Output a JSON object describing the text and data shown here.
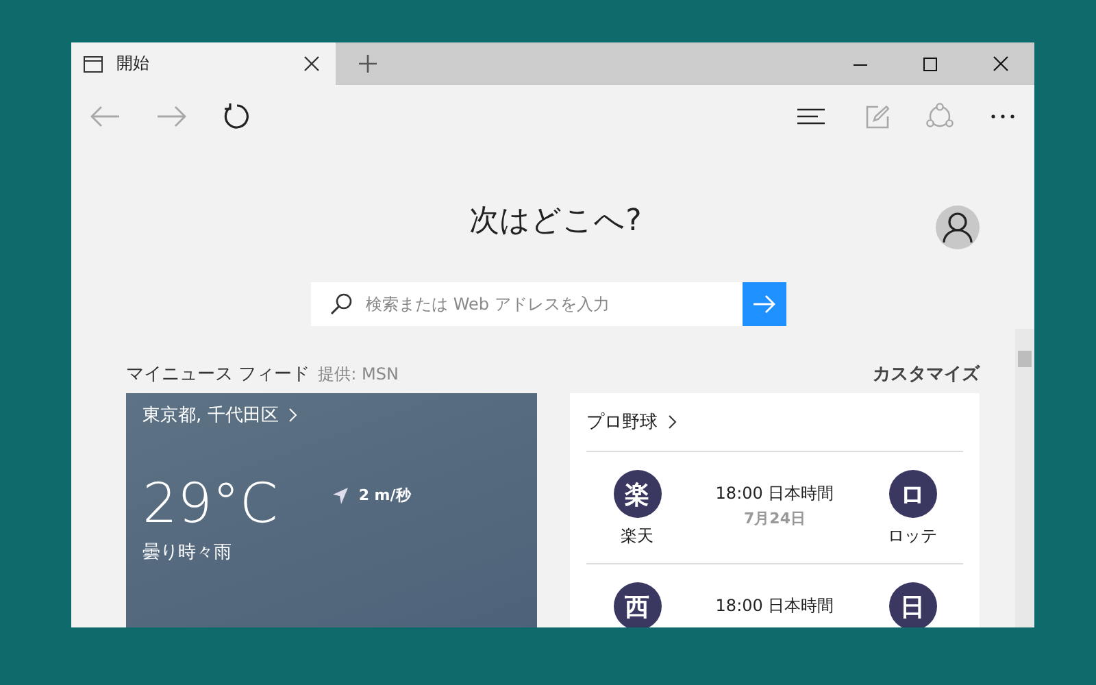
{
  "tab": {
    "title": "開始",
    "selected": true
  },
  "nav": {
    "back_disabled": true,
    "forward_disabled": true
  },
  "heading": "次はどこへ?",
  "search": {
    "placeholder": "検索または Web アドレスを入力"
  },
  "feed": {
    "title": "マイニュース フィード",
    "provider": "提供: MSN",
    "customize": "カスタマイズ"
  },
  "weather": {
    "location": "東京都, 千代田区",
    "temperature": "29°C",
    "wind": "2 m/秒",
    "condition": "曇り時々雨"
  },
  "sports": {
    "title": "プロ野球",
    "games": [
      {
        "home": {
          "logo": "楽",
          "name": "楽天"
        },
        "time": "18:00 日本時間",
        "date": "7月24日",
        "away": {
          "logo": "ロ",
          "name": "ロッテ"
        }
      },
      {
        "home": {
          "logo": "西"
        },
        "time": "18:00 日本時間",
        "away": {
          "logo": "日"
        }
      }
    ]
  }
}
